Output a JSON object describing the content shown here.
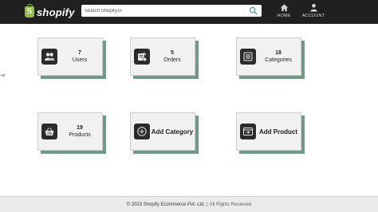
{
  "brand": {
    "name": "shopify",
    "glyph": "S"
  },
  "search": {
    "placeholder": "Search Shopify.in"
  },
  "nav": {
    "home": {
      "label": "HOME",
      "icon": "home-icon"
    },
    "account": {
      "label": "ACCOUNT",
      "icon": "user-icon"
    }
  },
  "cards": {
    "users": {
      "count": "7",
      "label": "Users",
      "icon": "users-icon"
    },
    "orders": {
      "count": "5",
      "label": "Orders",
      "icon": "orders-icon"
    },
    "categories": {
      "count": "18",
      "label": "Categories",
      "icon": "categories-icon"
    },
    "products": {
      "count": "19",
      "label": "Products",
      "icon": "products-basket-icon"
    },
    "add_category": {
      "label": "Add Category",
      "icon": "plus-circle-icon"
    },
    "add_product": {
      "label": "Add Product",
      "icon": "add-product-icon"
    }
  },
  "footer": {
    "copyright": "© 2023 Shopify Ecommerce Pvt. Ltd.",
    "separator": "|",
    "rights": "All Rights Reserved"
  },
  "colors": {
    "topbar": "#202020",
    "card_shadow": "#6f9a85",
    "brand_green": "#95bf47",
    "search_icon": "#3fa88a"
  }
}
